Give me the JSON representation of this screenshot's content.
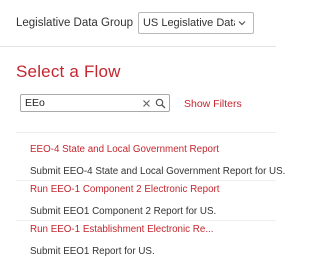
{
  "header": {
    "ldg_label": "Legislative Data Group",
    "ldg_value": "US Legislative Data Group"
  },
  "main": {
    "title": "Select a Flow",
    "search": {
      "value": "EEo",
      "placeholder": ""
    },
    "show_filters": "Show Filters",
    "flows": [
      {
        "title": "EEO-4 State and Local Government Report",
        "description": "Submit EEO-4 State and Local Government Report for US."
      },
      {
        "title": "Run EEO-1 Component 2 Electronic Report",
        "description": "Submit EEO1 Component 2 Report for US."
      },
      {
        "title": "Run EEO-1 Establishment Electronic Re...",
        "description": "Submit EEO1 Report for US."
      }
    ]
  },
  "colors": {
    "accent": "#c4262e",
    "text": "#333333",
    "border": "#b9b9b9"
  },
  "icons": {
    "dropdown": "chevron-down-icon",
    "clear": "close-icon",
    "search": "search-icon"
  }
}
